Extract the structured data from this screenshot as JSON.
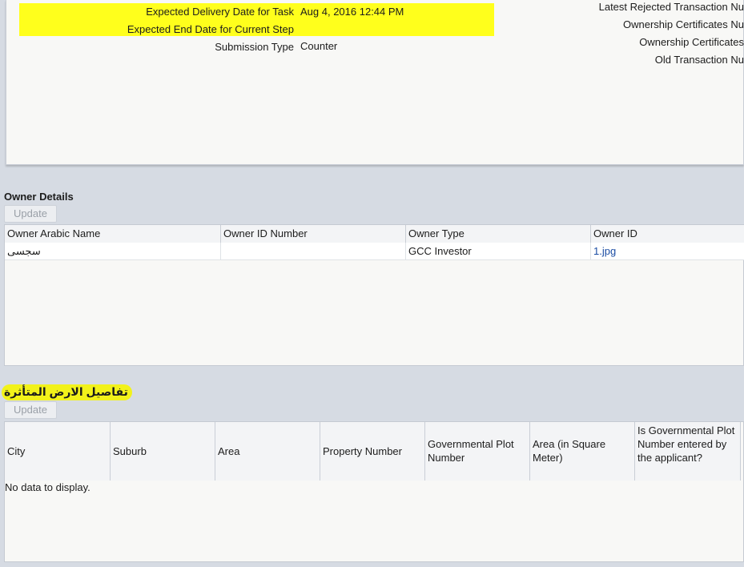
{
  "task_info": {
    "expected_delivery_label": "Expected Delivery Date for Task",
    "expected_delivery_value": "Aug 4, 2016 12:44 PM",
    "expected_end_label": "Expected End Date for Current Step",
    "submission_type_label": "Submission Type",
    "submission_type_value": "Counter",
    "right_labels": [
      "Latest Rejected Transaction Nu",
      "Ownership Certificates Nu",
      "Ownership Certificates",
      "Old Transaction Nu"
    ]
  },
  "owner_details": {
    "title": "Owner Details",
    "update_label": "Update",
    "columns": [
      "Owner Arabic Name",
      "Owner ID Number",
      "Owner Type",
      "Owner ID"
    ],
    "rows": [
      [
        "سجسى",
        "",
        "GCC Investor",
        "1.jpg"
      ]
    ]
  },
  "land_details": {
    "title": "تفاصيل الارض المتأثرة",
    "update_label": "Update",
    "columns": [
      "City",
      "Suburb",
      "Area",
      "Property Number",
      "Governmental Plot Number",
      "Area (in Square Meter)",
      "Is Governmental Plot Number entered by the applicant?"
    ],
    "empty_text": "No data to display."
  },
  "colors": {
    "highlight": "#ffff1c",
    "link": "#1a4ca3",
    "background": "#d6dbe3"
  }
}
